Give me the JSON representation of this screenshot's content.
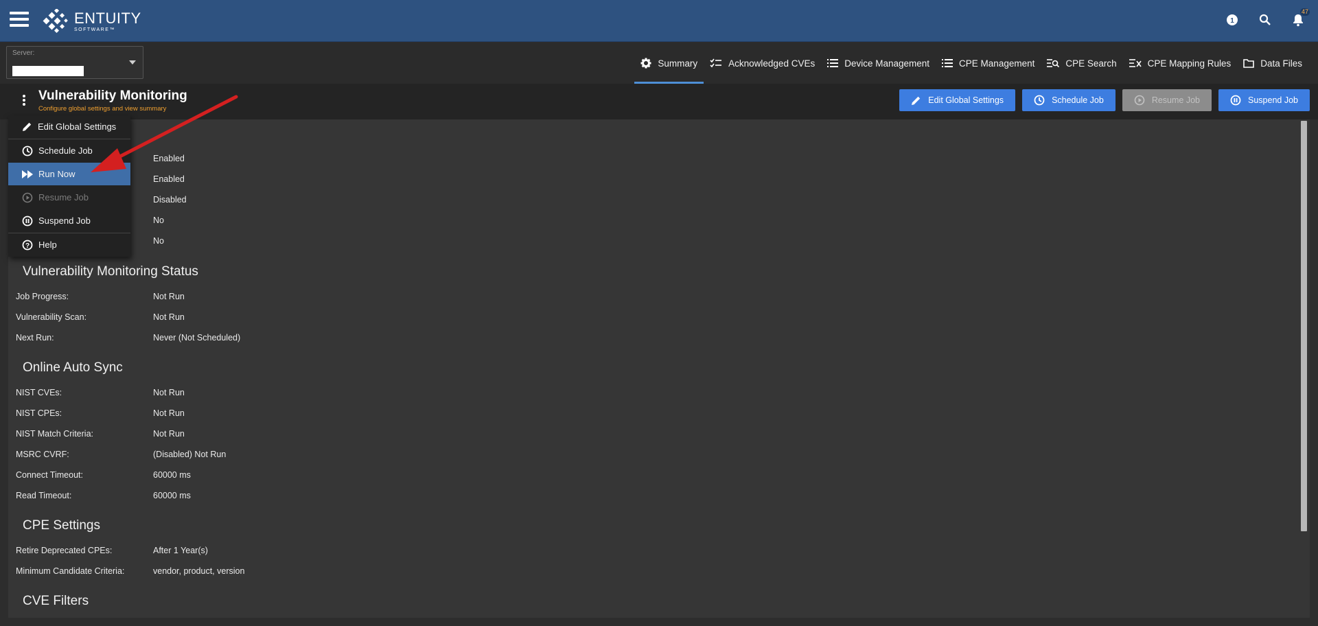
{
  "app": {
    "logo_main": "ENTUITY",
    "logo_sub": "SOFTWARE™",
    "notification_count": "47"
  },
  "server": {
    "label": "Server:",
    "value": ""
  },
  "tabs": [
    {
      "label": "Summary",
      "icon": "gear-icon"
    },
    {
      "label": "Acknowledged CVEs",
      "icon": "checklist-icon"
    },
    {
      "label": "Device Management",
      "icon": "list-icon"
    },
    {
      "label": "CPE Management",
      "icon": "list-icon"
    },
    {
      "label": "CPE Search",
      "icon": "search-list-icon"
    },
    {
      "label": "CPE Mapping Rules",
      "icon": "mapping-list-icon"
    },
    {
      "label": "Data Files",
      "icon": "folder-icon"
    }
  ],
  "page": {
    "title": "Vulnerability Monitoring",
    "subtitle": "Configure global settings and view summary"
  },
  "actions": {
    "edit_global_settings": "Edit Global Settings",
    "schedule_job": "Schedule Job",
    "resume_job": "Resume Job",
    "suspend_job": "Suspend Job"
  },
  "menu": {
    "edit_global_settings": "Edit Global Settings",
    "schedule_job": "Schedule Job",
    "run_now": "Run Now",
    "resume_job": "Resume Job",
    "suspend_job": "Suspend Job",
    "help": "Help"
  },
  "general": {
    "values": [
      "Enabled",
      "Enabled",
      "Disabled",
      "No",
      "No"
    ]
  },
  "status": {
    "title": "Vulnerability Monitoring Status",
    "rows": [
      {
        "label": "Job Progress:",
        "value": "Not Run"
      },
      {
        "label": "Vulnerability Scan:",
        "value": "Not Run"
      },
      {
        "label": "Next Run:",
        "value": "Never (Not Scheduled)"
      }
    ]
  },
  "sync": {
    "title": "Online Auto Sync",
    "rows": [
      {
        "label": "NIST CVEs:",
        "value": "Not Run"
      },
      {
        "label": "NIST CPEs:",
        "value": "Not Run"
      },
      {
        "label": "NIST Match Criteria:",
        "value": "Not Run"
      },
      {
        "label": "MSRC CVRF:",
        "value": "(Disabled) Not Run"
      },
      {
        "label": "Connect Timeout:",
        "value": "60000 ms"
      },
      {
        "label": "Read Timeout:",
        "value": "60000 ms"
      }
    ]
  },
  "cpe": {
    "title": "CPE Settings",
    "rows": [
      {
        "label": "Retire Deprecated CPEs:",
        "value": "After 1 Year(s)"
      },
      {
        "label": "Minimum Candidate Criteria:",
        "value": "vendor, product, version"
      }
    ]
  },
  "filters": {
    "title": "CVE Filters"
  },
  "colors": {
    "topbar": "#2e5280",
    "accent": "#3d7de0",
    "menu_active": "#3f6ea8",
    "subtitle": "#f0a030",
    "annotation_arrow": "#d42020"
  }
}
